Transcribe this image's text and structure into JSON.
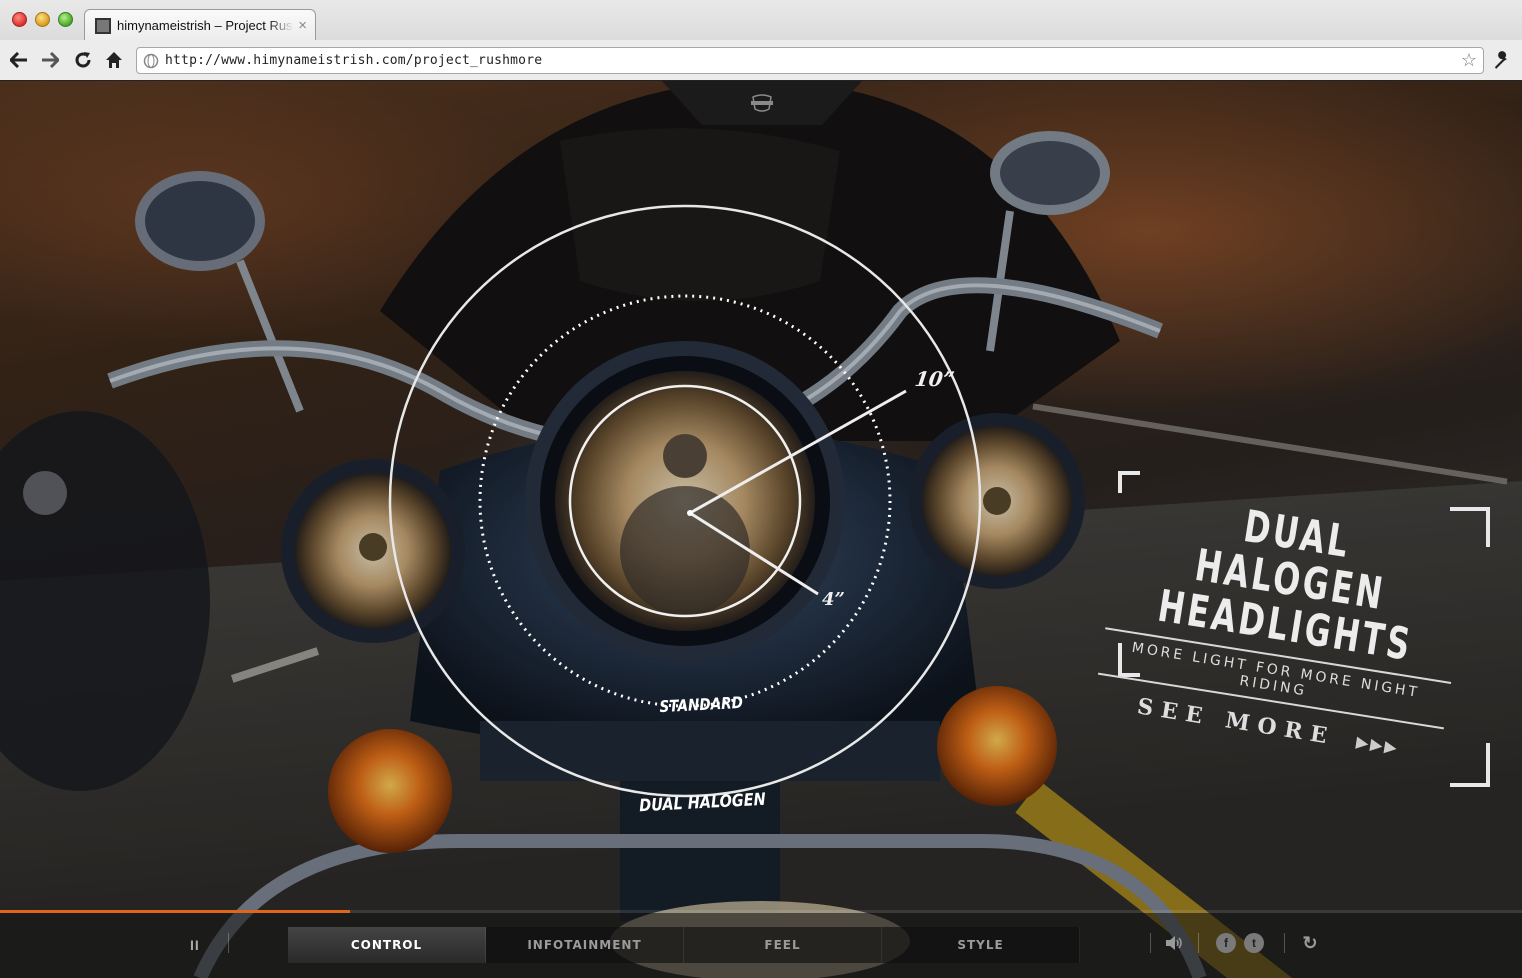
{
  "browser": {
    "tab_title": "himynameistrish – Project Rushmore",
    "tab_close": "×",
    "url": "http://www.himynameistrish.com/project_rushmore",
    "star_icon": "☆"
  },
  "hero": {
    "badge_icon": "bar-and-shield-icon",
    "callout": {
      "headline_line1": "DUAL HALOGEN",
      "headline_line2": "HEADLIGHTS",
      "subline": "MORE LIGHT FOR MORE NIGHT RIDING",
      "see_more": "SEE MORE",
      "arrows": "▶▶▶"
    },
    "diagram": {
      "label_10": "10”",
      "label_4": "4”",
      "label_standard": "STANDARD",
      "label_dual": "DUAL HALOGEN"
    }
  },
  "bottom_bar": {
    "progress": 0.23,
    "pause_label": "II",
    "tabs": [
      {
        "label": "CONTROL",
        "active": true
      },
      {
        "label": "INFOTAINMENT",
        "active": false
      },
      {
        "label": "FEEL",
        "active": false
      },
      {
        "label": "STYLE",
        "active": false
      }
    ],
    "sound_icon": "speaker-icon",
    "facebook_label": "f",
    "twitter_label": "t",
    "replay_icon": "↻"
  },
  "colors": {
    "accent": "#e0661b",
    "headline": "#ececec"
  }
}
